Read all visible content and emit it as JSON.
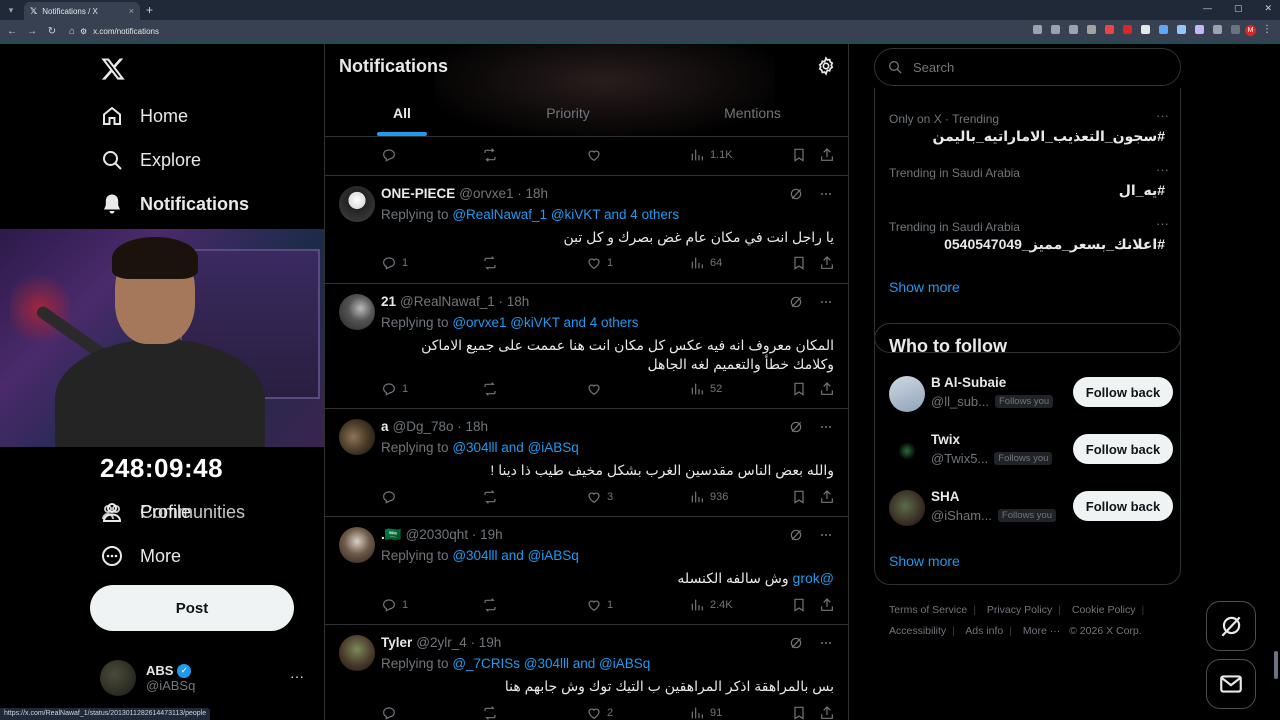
{
  "browser": {
    "tab_title": "Notifications / X",
    "tab_close": "×",
    "new_tab": "+",
    "url": "x.com/notifications",
    "status_url": "https://x.com/RealNawaf_1/status/2013011282614473113/people"
  },
  "nav": {
    "home": "Home",
    "explore": "Explore",
    "notifications": "Notifications",
    "communities": "Communities",
    "profile": "Profile",
    "more": "More",
    "post": "Post"
  },
  "overlay": {
    "timer": "248:09:48"
  },
  "account": {
    "name": "ABS",
    "handle": "@iABSq",
    "dots": "···"
  },
  "header": {
    "title": "Notifications",
    "tabs": [
      "All",
      "Priority",
      "Mentions"
    ]
  },
  "top_actions": {
    "views": "1.1K"
  },
  "tweets": [
    {
      "name": "ONE-PIECE",
      "meta": "@orvxe1 · 18h",
      "replying": "Replying to",
      "mentions": "@RealNawaf_1 @kiVKT and 4 others",
      "body": "يا راجل انت في مكان عام غض بصرك و كل تبن",
      "replies": "1",
      "likes": "1",
      "views": "64"
    },
    {
      "name": "21",
      "meta": "@RealNawaf_1 · 18h",
      "replying": "Replying to",
      "mentions": "@orvxe1 @kiVKT and 4 others",
      "body": "المكان معروف انه فيه عكس كل مكان انت هنا عممت على جميع الاماكن وكلامك خطأ والتعميم لغه الجاهل",
      "replies": "1",
      "likes": "",
      "views": "52"
    },
    {
      "name": "a",
      "meta": "@Dg_78o · 18h",
      "replying": "Replying to",
      "mentions": "@304lll and @iABSq",
      "body": "والله بعض الناس مقدسين الغرب بشكل مخيف طيب ذا دينا !",
      "replies": "",
      "likes": "3",
      "views": "936"
    },
    {
      "name": ".🇸🇦",
      "meta": "@2030qht · 19h",
      "replying": "Replying to",
      "mentions": "@304lll and @iABSq",
      "body_mention": "@grok",
      "body": "وش سالفه الكنسله",
      "replies": "1",
      "likes": "1",
      "views": "2.4K"
    },
    {
      "name": "Tyler",
      "meta": "@2ylr_4 · 19h",
      "replying": "Replying to",
      "mentions": "@_7CRISs @304lll and @iABSq",
      "body": "بس بالمراهقة اذكر المراهقين ب التيك توك وش جابهم هنا",
      "replies": "",
      "likes": "2",
      "views": "91"
    }
  ],
  "right": {
    "search_placeholder": "Search",
    "trends": [
      {
        "context": "Only on X · Trending",
        "title": "#سجون_التعذيب_الاماراتيه_باليمن"
      },
      {
        "context": "Trending in Saudi Arabia",
        "title": "#يه_ال"
      },
      {
        "context": "Trending in Saudi Arabia",
        "title": "#اعلانك_بسعر_مميز_0540547049"
      }
    ],
    "trend_more": "···",
    "show_more": "Show more",
    "who_to_follow": "Who to follow",
    "follow": [
      {
        "name": "B Al-Subaie",
        "handle": "@ll_sub...",
        "badge": "Follows you",
        "button": "Follow back"
      },
      {
        "name": "Twix",
        "handle": "@Twix5...",
        "badge": "Follows you",
        "button": "Follow back"
      },
      {
        "name": "SHA",
        "handle": "@iSham...",
        "badge": "Follows you",
        "button": "Follow back"
      }
    ],
    "show_more_2": "Show more",
    "footer": {
      "terms": "Terms of Service",
      "privacy": "Privacy Policy",
      "cookie": "Cookie Policy",
      "access": "Accessibility",
      "ads": "Ads info",
      "more": "More ···",
      "copy": "© 2026 X Corp."
    }
  },
  "colors": {
    "accent": "#1d9bf0",
    "border": "#2f3336",
    "muted": "#71767b"
  }
}
